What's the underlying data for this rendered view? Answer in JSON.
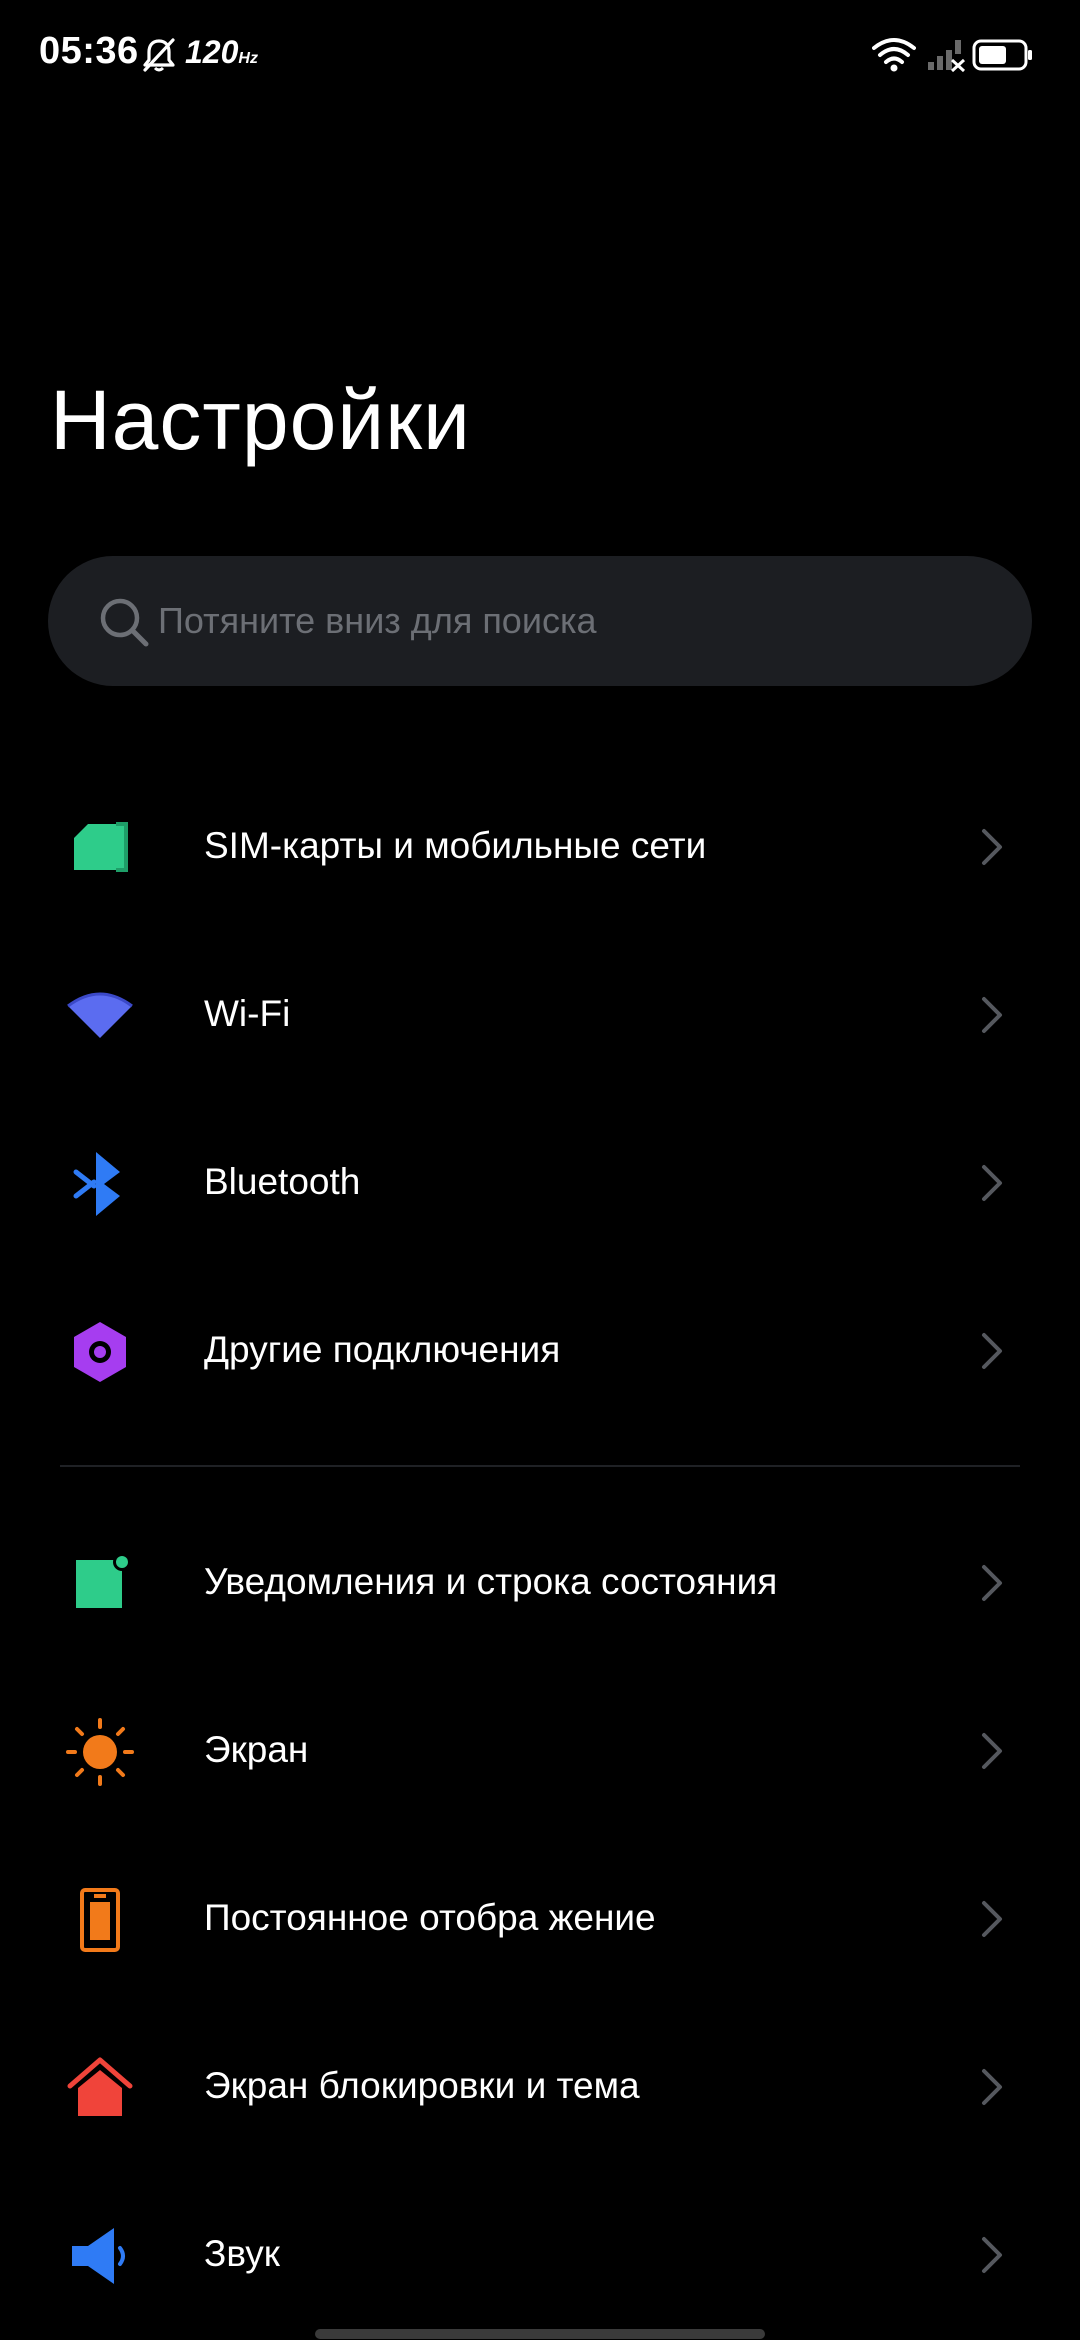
{
  "status_bar": {
    "time": "05:36",
    "refresh_rate": "120",
    "refresh_unit": "Hz",
    "icons": [
      "bell-muted-icon",
      "wifi-icon",
      "signal-no-service-icon",
      "battery-icon"
    ],
    "battery_level": 0.6
  },
  "header": {
    "title": "Настройки"
  },
  "search": {
    "placeholder": "Потяните вниз для поиска"
  },
  "settings": {
    "items": [
      {
        "label": "SIM-карты и мобильные сети",
        "icon": "sim-card-icon",
        "color": "#2ecc8a"
      },
      {
        "label": "Wi-Fi",
        "icon": "wifi-icon",
        "color": "#5b6cf0"
      },
      {
        "label": "Bluetooth",
        "icon": "bluetooth-icon",
        "color": "#2f7bf5"
      },
      {
        "label": "Другие подключения",
        "icon": "connection-hex-icon",
        "color": "#a63df0"
      },
      {
        "label": "Уведомления и строка состояния",
        "icon": "notification-icon",
        "color": "#2ecc8a"
      },
      {
        "label": "Экран",
        "icon": "sun-icon",
        "color": "#f27a1a"
      },
      {
        "label": "Постоянное отобра жение",
        "icon": "always-on-display-icon",
        "color": "#f27a1a"
      },
      {
        "label": "Экран блокировки и тема",
        "icon": "home-theme-icon",
        "color": "#f0443a"
      },
      {
        "label": "Звук",
        "icon": "speaker-icon",
        "color": "#2f7bf5"
      }
    ]
  },
  "colors": {
    "background": "#000000",
    "search_background": "#1c1e22",
    "placeholder": "#6c6f75",
    "chevron": "#55585e"
  }
}
